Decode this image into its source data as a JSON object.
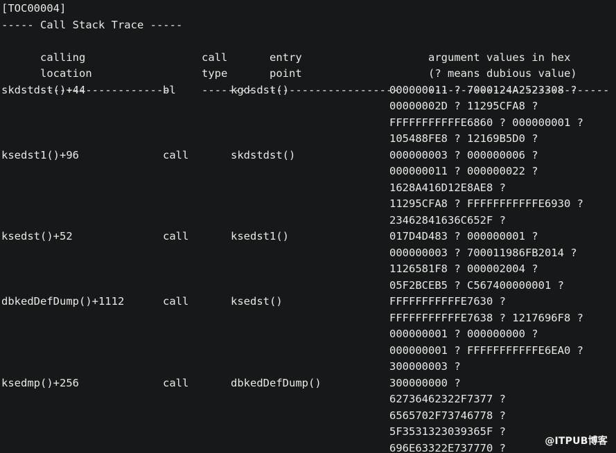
{
  "terminal": {
    "background_color": "#17181a",
    "text_color": "#e8e8e6",
    "tag": "[TOC00004]",
    "section_title": "----- Call Stack Trace -----",
    "watermark": "@ITPUB博客"
  },
  "header": {
    "row1": {
      "location": "calling",
      "type": "call",
      "entry": "entry",
      "args": "argument values in hex"
    },
    "row2": {
      "location": "location",
      "type": "type",
      "entry": "point",
      "args": "(? means dubious value)"
    },
    "rule": {
      "location": "--------------------",
      "type": "--------",
      "entry": "--------------------",
      "args": "----------------------------"
    }
  },
  "frames": [
    {
      "location": "skdstdst()+44",
      "type": "bl",
      "entry": "kgdsdst()",
      "args": [
        "000000011 ? 7000124A2523308 ?",
        "00000002D ? 11295CFA8 ?",
        "FFFFFFFFFFFE6860 ? 000000001 ?",
        "105488FE8 ? 12169B5D0 ?"
      ]
    },
    {
      "location": "ksedst1()+96",
      "type": "call",
      "entry": "skdstdst()",
      "args": [
        "000000003 ? 000000006 ?",
        "000000011 ? 000000022 ?",
        "1628A416D12E8AE8 ?",
        "11295CFA8 ? FFFFFFFFFFFE6930 ?",
        "23462841636C652F ?"
      ]
    },
    {
      "location": "ksedst()+52",
      "type": "call",
      "entry": "ksedst1()",
      "args": [
        "017D4D483 ? 000000001 ?",
        "000000003 ? 700011986FB2014 ?",
        "1126581F8 ? 000002004 ?",
        "05F2BCEB5 ? C567400000001 ?"
      ]
    },
    {
      "location": "dbkedDefDump()+1112",
      "type": "call",
      "entry": "ksedst()",
      "args": [
        "FFFFFFFFFFFE7630 ?",
        "FFFFFFFFFFFE7638 ? 1217696F8 ?",
        "000000001 ? 000000000 ?",
        "000000001 ? FFFFFFFFFFFE6EA0 ?",
        "300000003 ?"
      ]
    },
    {
      "location": "ksedmp()+256",
      "type": "call",
      "entry": "dbkedDefDump()",
      "args": [
        "300000000 ?",
        "62736462322F7377 ?",
        "6565702F73746778 ?",
        "5F3531323039365F ?",
        "696E63322E737770 ?"
      ]
    }
  ]
}
